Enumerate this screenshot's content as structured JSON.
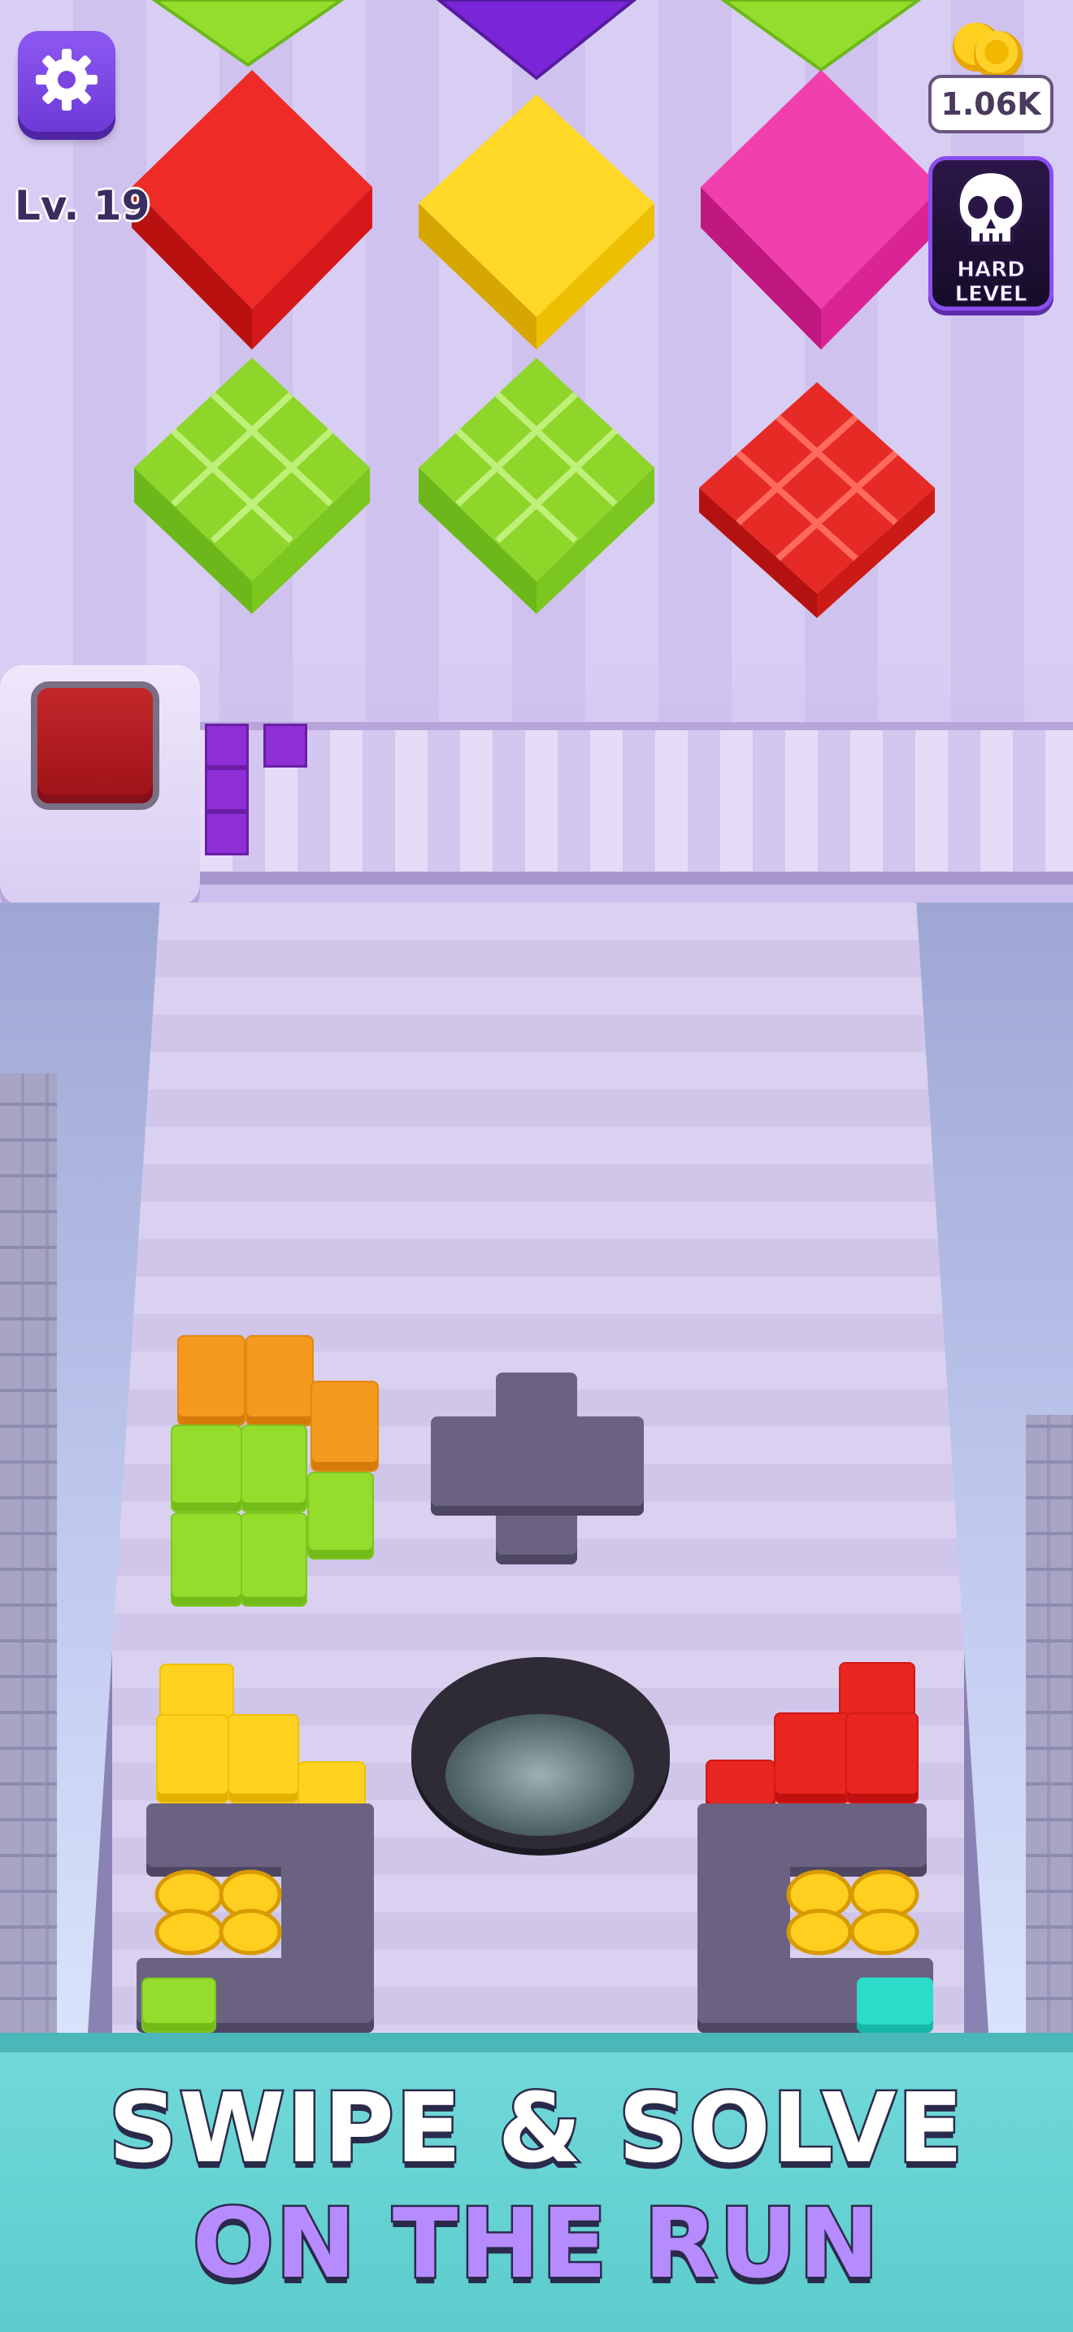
{
  "hud": {
    "level_label": "Lv. 19",
    "coins": "1.06K",
    "hard_level_line1": "HARD",
    "hard_level_line2": "LEVEL"
  },
  "icons": {
    "settings": "gear-icon",
    "coins": "coin-stack-icon",
    "hard_level": "skull-icon"
  },
  "banner": {
    "line1": "SWIPE & SOLVE",
    "line2": "ON THE RUN"
  },
  "colors": {
    "red": "#e8251f",
    "yellow": "#ffd21f",
    "magenta": "#f03aa8",
    "lime": "#94dd2c",
    "purple": "#8f2fd6",
    "orange": "#f59a1f",
    "teal": "#2bdcc8",
    "banner": "#5ccccd"
  }
}
